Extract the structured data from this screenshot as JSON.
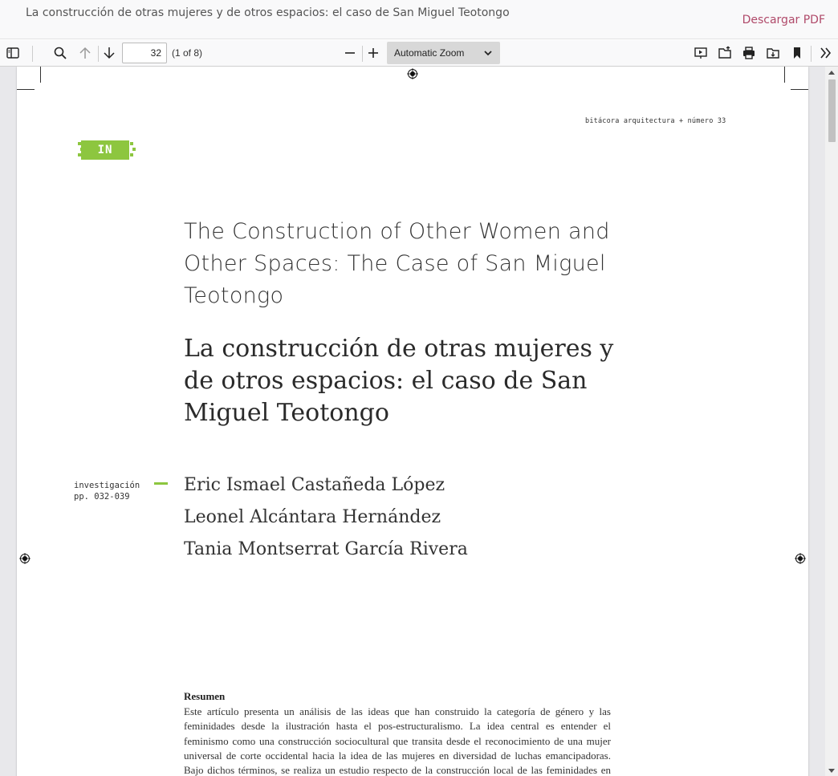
{
  "header": {
    "title": "La construcción de otras mujeres y de otros espacios: el caso de San Miguel Teotongo",
    "download_label": "Descargar PDF"
  },
  "toolbar": {
    "page_number": "32",
    "page_count": "(1 of 8)",
    "zoom_label": "Automatic Zoom"
  },
  "page": {
    "journal_line": "bitácora arquitectura + número 33",
    "badge": "IN",
    "title_en": "The Construction of Other Women and Other Spaces: The Case of San Miguel Teotongo",
    "title_es": "La construcción de otras mujeres y de otros espacios: el caso de San Miguel Teotongo",
    "section": "investigación",
    "pages": "pp. 032-039",
    "authors": [
      "Eric Ismael Castañeda López",
      "Leonel Alcántara Hernández",
      "Tania Montserrat García Rivera"
    ],
    "abstract_heading": "Resumen",
    "abstract_text": "Este artículo presenta un análisis de las ideas que han construido la categoría de género y las feminidades desde la ilustración hasta el pos-estructuralismo. La idea central es entender el feminismo como una construcción sociocultural que transita desde el reconocimiento de una mujer universal de corte occidental hacia la idea de las mujeres en diversidad de luchas emancipadoras. Bajo dichos términos, se realiza un estudio respecto de la construcción local de las feminidades en San Miguel Teotongo, sus"
  },
  "colors": {
    "accent_green": "#8dc63f",
    "download_link": "#b04a6a"
  }
}
